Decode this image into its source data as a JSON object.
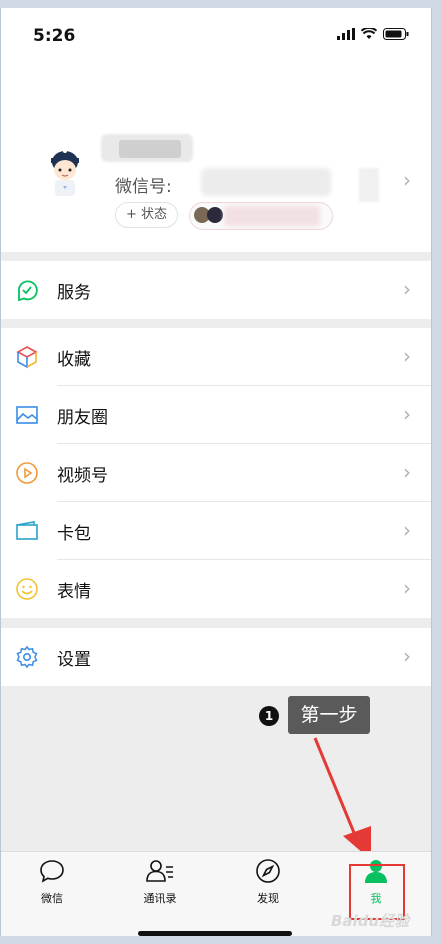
{
  "status_bar": {
    "time": "5:26"
  },
  "profile": {
    "wechat_id_label": "微信号:",
    "status_button": "+ 状态"
  },
  "menu": {
    "service": "服务",
    "favorites": "收藏",
    "moments": "朋友圈",
    "channels": "视频号",
    "cards": "卡包",
    "stickers": "表情",
    "settings": "设置"
  },
  "tabbar": {
    "chats": "微信",
    "contacts": "通讯录",
    "discover": "发现",
    "me": "我"
  },
  "annotation": {
    "step_number": "1",
    "step_text": "第一步"
  },
  "watermark": "Baidu经验",
  "colors": {
    "accent": "#07c160",
    "annotation_red": "#e53935"
  }
}
